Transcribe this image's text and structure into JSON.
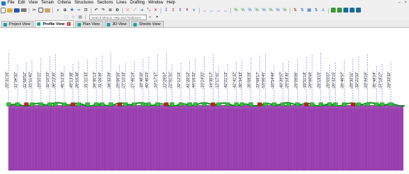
{
  "menu": {
    "items": [
      "File",
      "Edit",
      "View",
      "Terrain",
      "Criteria",
      "Structures",
      "Sections",
      "Lines",
      "Drafting",
      "Window",
      "Help"
    ]
  },
  "window_controls": {
    "minimize": "–",
    "close": "×"
  },
  "search": {
    "placeholder": "Search Menus, Help and Toolboxes"
  },
  "tabs": [
    {
      "label": "Project View",
      "active": false,
      "icon_color": "#1aa39a"
    },
    {
      "label": "Profile View",
      "active": true,
      "icon_color": "#1aa39a",
      "closable": true
    },
    {
      "label": "Plan View",
      "active": false,
      "icon_color": "#1aa39a"
    },
    {
      "label": "3D View",
      "active": false,
      "icon_color": "#1aa39a"
    },
    {
      "label": "Sheets View",
      "active": false,
      "icon_color": "#1aa39a"
    }
  ],
  "profile": {
    "colors": {
      "fill": "#a54aba",
      "fill_lines": "#7d2a91",
      "ground_line": "#0e8f2a",
      "marker": "#30c030",
      "marker_red": "#d01818",
      "guide": "#4a4ae0"
    },
    "labels": [
      "-20°31'16\"",
      "-11°34'32\"",
      "-11°50'52\"",
      "-15°11'42\"",
      "-19°55'21\"",
      "-32°10'33\"",
      "-36°23'35\"",
      "-45°12'33\"",
      "-49°13'38\"",
      "-29°15'38\"",
      "-31°21'33\"",
      "-34°30'13\"",
      "-31°26'39\"",
      "-34°32'29\"",
      "-29°06'55\"",
      "-27°10'33\"",
      "-27°46'14\"",
      "-18°48'32\"",
      "-40°48'23\"",
      "-10°17'37\"",
      "-12°29'07\"",
      "-22°01'51\"",
      "-32°12'15\"",
      "-41°20'12\"",
      "-44°16'32\"",
      "-10°24'32\"",
      "-14°36'17\"",
      "-12°17'41\"",
      "-42°21'13\"",
      "-42°41'32\"",
      "-30°34'33\"",
      "-35°08'28\"",
      "-37°08'17\"",
      "-53°06'45\"",
      "-10°54'44\"",
      "-40°39'07\"",
      "-29°54'45\"",
      "-24°06'06\"",
      "-18°51'18\"",
      "-29°06'50\"",
      "-28°18'15\"",
      "-20°55'07\"",
      "-26°32'15\"",
      "-26°46'57\"",
      "-29°32'11\"",
      "-32°21'52\"",
      "-33°44'16\"",
      "-35°48'24\"",
      "-37°18'27\"",
      "-29°33'32\""
    ]
  }
}
